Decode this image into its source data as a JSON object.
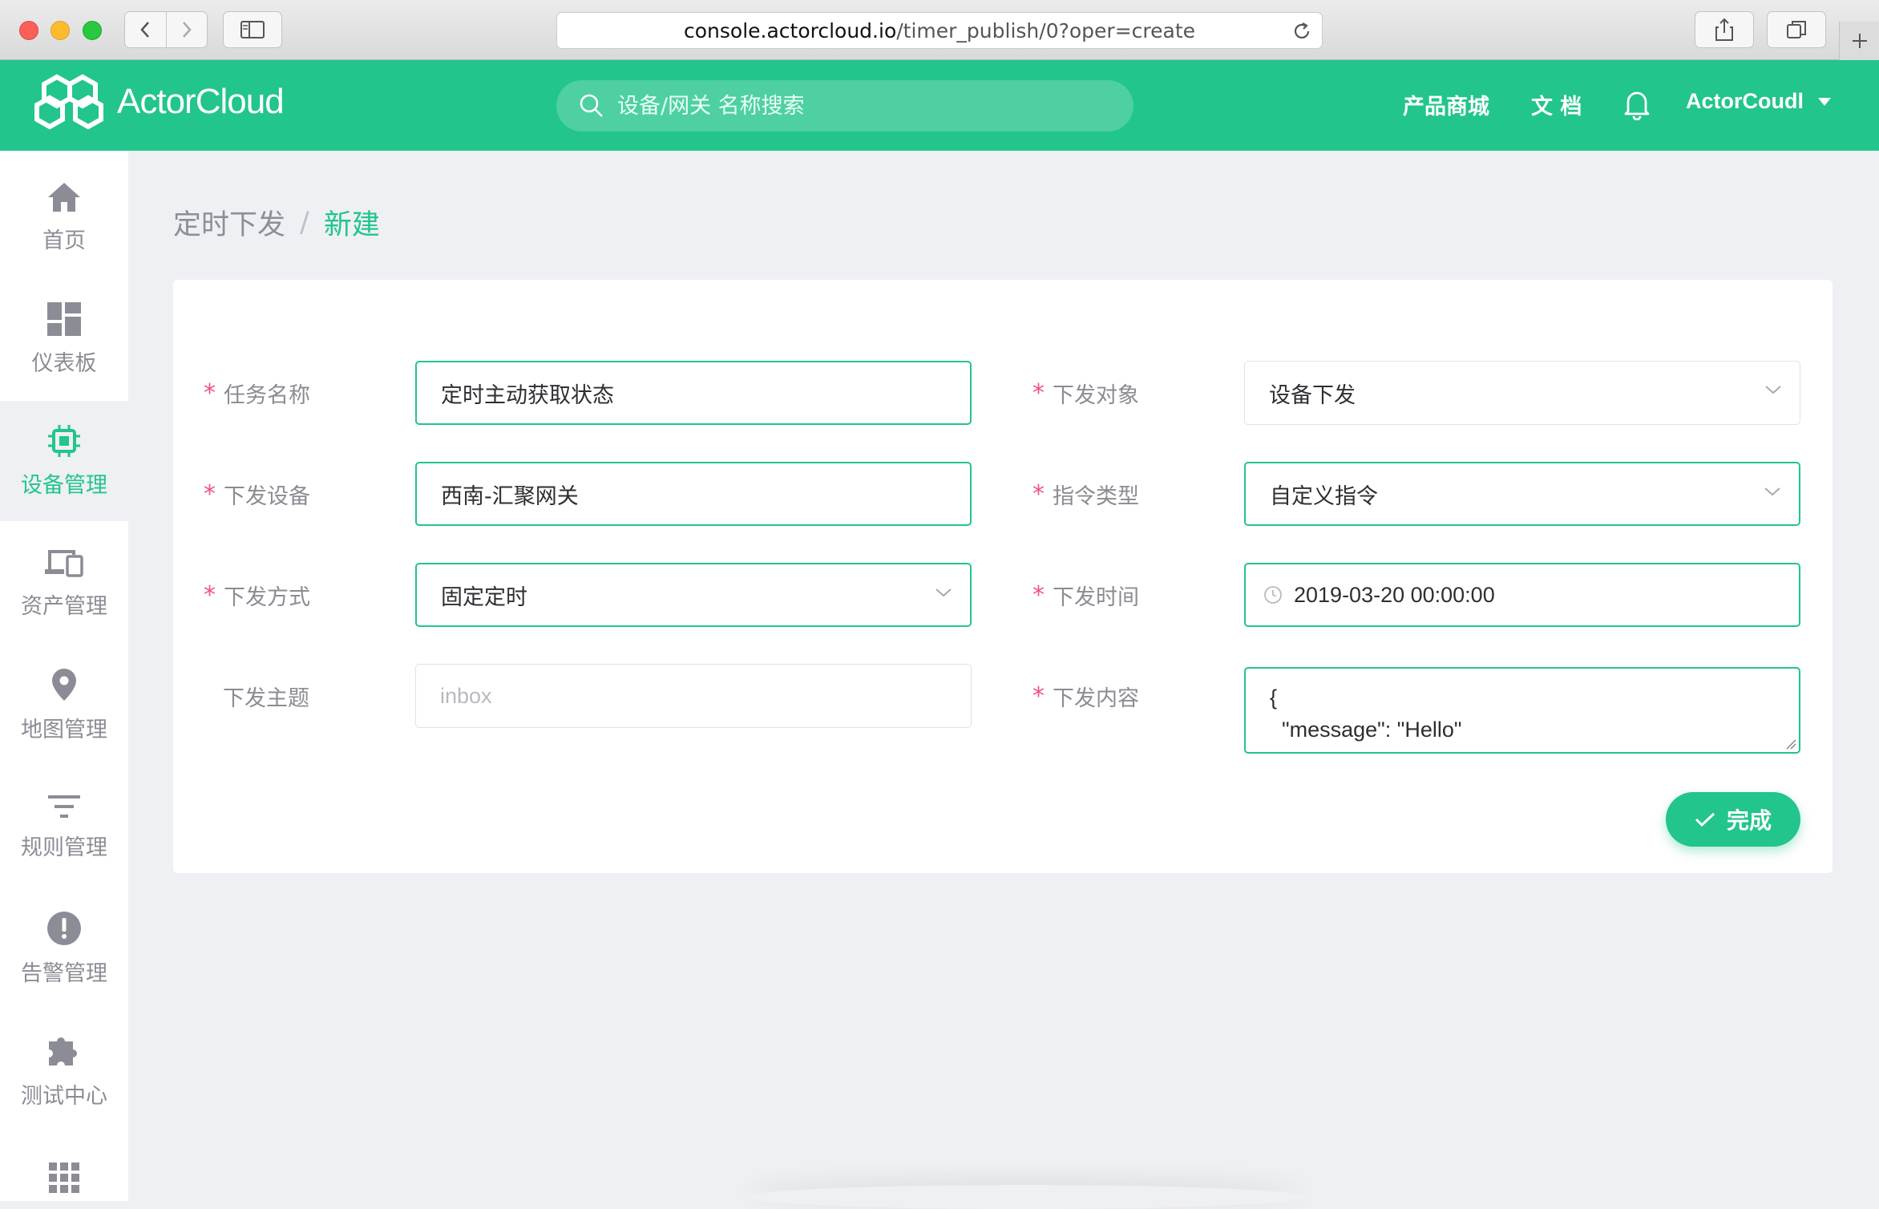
{
  "browser": {
    "url_host": "console.actorcloud.io",
    "url_path": "/timer_publish/0?oper=create"
  },
  "header": {
    "logo_text": "ActorCloud",
    "search_placeholder": "设备/网关 名称搜索",
    "store_link": "产品商城",
    "docs_link": "文 档",
    "username": "ActorCoudl",
    "brand_color": "#22c58b"
  },
  "sidebar": {
    "items": [
      {
        "label": "首页",
        "icon": "home-icon"
      },
      {
        "label": "仪表板",
        "icon": "dashboard-icon"
      },
      {
        "label": "设备管理",
        "icon": "chip-icon",
        "active": true
      },
      {
        "label": "资产管理",
        "icon": "devices-icon"
      },
      {
        "label": "地图管理",
        "icon": "map-pin-icon"
      },
      {
        "label": "规则管理",
        "icon": "filter-icon"
      },
      {
        "label": "告警管理",
        "icon": "alert-icon"
      },
      {
        "label": "测试中心",
        "icon": "puzzle-icon"
      },
      {
        "label": "",
        "icon": "apps-grid-icon"
      }
    ]
  },
  "breadcrumb": {
    "root": "定时下发",
    "separator": "/",
    "current": "新建"
  },
  "form": {
    "task_name": {
      "label": "任务名称",
      "value": "定时主动获取状态"
    },
    "target": {
      "label": "下发对象",
      "value": "设备下发"
    },
    "device": {
      "label": "下发设备",
      "value": "西南-汇聚网关"
    },
    "command_type": {
      "label": "指令类型",
      "value": "自定义指令"
    },
    "publish_mode": {
      "label": "下发方式",
      "value": "固定定时"
    },
    "publish_time": {
      "label": "下发时间",
      "value": "2019-03-20 00:00:00"
    },
    "topic": {
      "label": "下发主题",
      "placeholder": "inbox"
    },
    "content": {
      "label": "下发内容",
      "value": "{\n  \"message\": \"Hello\""
    },
    "required_mark": "*",
    "submit_label": "完成"
  }
}
